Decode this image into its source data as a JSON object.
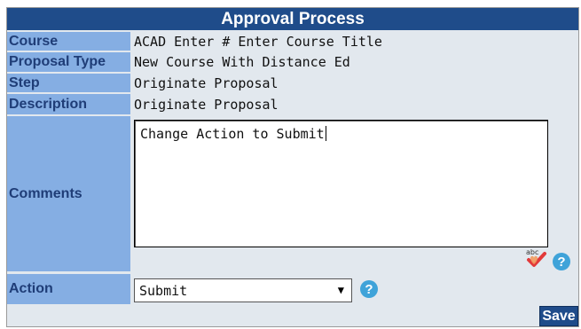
{
  "form": {
    "title": "Approval Process",
    "rows": {
      "course": {
        "label": "Course",
        "value": "ACAD Enter # Enter Course Title"
      },
      "proposal_type": {
        "label": "Proposal Type",
        "value": "New Course With Distance Ed"
      },
      "step": {
        "label": "Step",
        "value": "Originate Proposal"
      },
      "description": {
        "label": "Description",
        "value": "Originate Proposal"
      }
    },
    "comments": {
      "label": "Comments",
      "value": "Change Action to Submit"
    },
    "action": {
      "label": "Action",
      "selected": "Submit"
    },
    "save_label": "Save",
    "help_glyph": "?",
    "colors": {
      "header": "#1f4c8a",
      "label_bg": "#85aee3",
      "label_text": "#1f3d77",
      "value_bg": "#e2e8ee",
      "help": "#3fa3d9"
    },
    "icons": {
      "spellcheck": "spellcheck-icon",
      "help": "question-circle-icon",
      "dropdown": "chevron-down-icon"
    }
  }
}
